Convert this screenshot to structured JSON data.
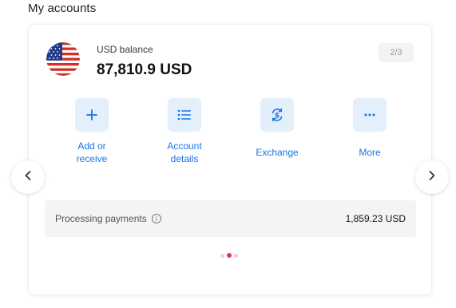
{
  "section": {
    "title": "My accounts"
  },
  "account": {
    "flag_icon": "us-flag-icon",
    "balance_label": "USD balance",
    "balance_value": "87,810.9 USD",
    "page_indicator": "2/3"
  },
  "actions": [
    {
      "label_line1": "Add or",
      "label_line2": "receive",
      "icon": "plus-icon"
    },
    {
      "label_line1": "Account",
      "label_line2": "details",
      "icon": "list-icon"
    },
    {
      "label": "Exchange",
      "icon": "exchange-icon"
    },
    {
      "label": "More",
      "icon": "more-icon"
    }
  ],
  "nav": {
    "prev_icon": "chevron-left-icon",
    "next_icon": "chevron-right-icon"
  },
  "processing": {
    "label": "Processing payments",
    "info_icon": "info-icon",
    "amount": "1,859.23 USD"
  },
  "pagination": {
    "count": 3,
    "active_index": 1
  },
  "colors": {
    "accent": "#1a73e8",
    "action_bg": "#e3effb",
    "dot_active": "#e8305f",
    "dot_inactive": "#f8c9d6"
  }
}
